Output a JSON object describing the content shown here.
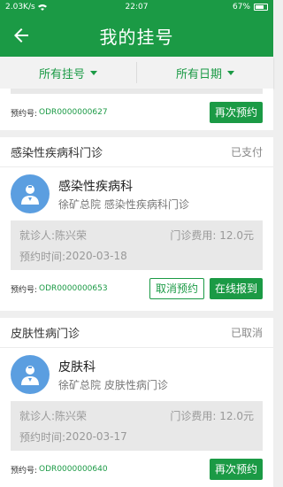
{
  "status_bar": {
    "speed": "2.03K/s",
    "time": "22:07",
    "battery": "67%"
  },
  "header": {
    "title": "我的挂号"
  },
  "filters": {
    "type_label": "所有挂号",
    "date_label": "所有日期"
  },
  "labels": {
    "order_prefix": "预约号:",
    "patient_prefix": "就诊人:",
    "fee_prefix": "门诊费用:",
    "time_prefix": "预约时间:"
  },
  "cards": [
    {
      "order_no": "ODR0000000627",
      "buttons": [
        "再次预约"
      ]
    },
    {
      "title": "感染性疾病科门诊",
      "status": "已支付",
      "department": "感染性疾病科",
      "hospital": "徐矿总院 感染性疾病科门诊",
      "patient": "陈兴荣",
      "fee": "12.0元",
      "date": "2020-03-18",
      "order_no": "ODR0000000653",
      "buttons": [
        "取消预约",
        "在线报到"
      ]
    },
    {
      "title": "皮肤性病门诊",
      "status": "已取消",
      "department": "皮肤科",
      "hospital": "徐矿总院 皮肤性病门诊",
      "patient": "陈兴荣",
      "fee": "12.0元",
      "date": "2020-03-17",
      "order_no": "ODR0000000640",
      "buttons": [
        "再次预约"
      ]
    }
  ],
  "colors": {
    "brand": "#1b9a45",
    "avatar": "#5b9ee0"
  },
  "icons": {
    "back": "arrow-left-icon",
    "avatar": "doctor-icon"
  }
}
